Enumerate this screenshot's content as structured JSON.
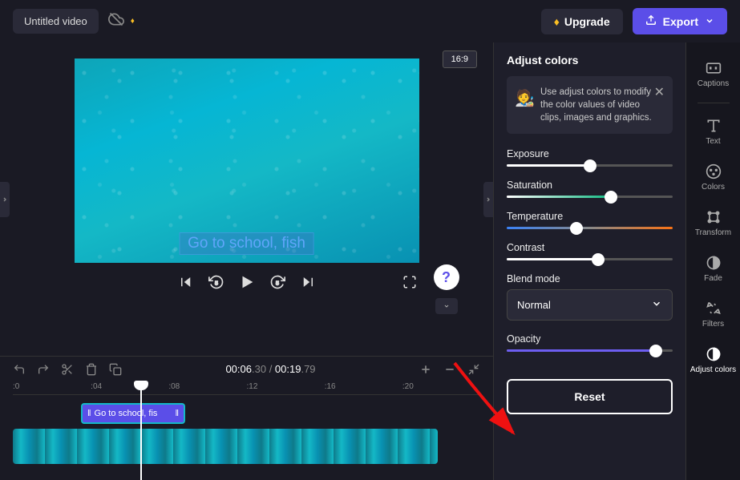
{
  "header": {
    "projectTitle": "Untitled video",
    "upgrade": "Upgrade",
    "export": "Export"
  },
  "preview": {
    "aspectRatio": "16:9",
    "captionText": "Go to school, fish"
  },
  "timeDisplay": {
    "currentPrefix": "00:06",
    "currentSuffix": ".30",
    "durationPrefix": "00:19",
    "durationSuffix": ".79"
  },
  "ruler": {
    "marks": [
      ":0",
      ":04",
      ":08",
      ":12",
      ":16",
      ":20"
    ]
  },
  "timeline": {
    "captionClip": "Go to school, fis"
  },
  "panel": {
    "title": "Adjust colors",
    "tip": "Use adjust colors to modify the color values of video clips, images and graphics.",
    "sliders": {
      "exposure": {
        "label": "Exposure",
        "value": 50
      },
      "saturation": {
        "label": "Saturation",
        "value": 63
      },
      "temperature": {
        "label": "Temperature",
        "value": 42
      },
      "contrast": {
        "label": "Contrast",
        "value": 55
      }
    },
    "blendMode": {
      "label": "Blend mode",
      "value": "Normal"
    },
    "opacity": {
      "label": "Opacity",
      "value": 90
    },
    "reset": "Reset"
  },
  "sidebar": {
    "items": [
      {
        "id": "captions",
        "label": "Captions"
      },
      {
        "id": "text",
        "label": "Text"
      },
      {
        "id": "colors",
        "label": "Colors"
      },
      {
        "id": "transform",
        "label": "Transform"
      },
      {
        "id": "fade",
        "label": "Fade"
      },
      {
        "id": "filters",
        "label": "Filters"
      },
      {
        "id": "adjust-colors",
        "label": "Adjust colors"
      }
    ]
  }
}
